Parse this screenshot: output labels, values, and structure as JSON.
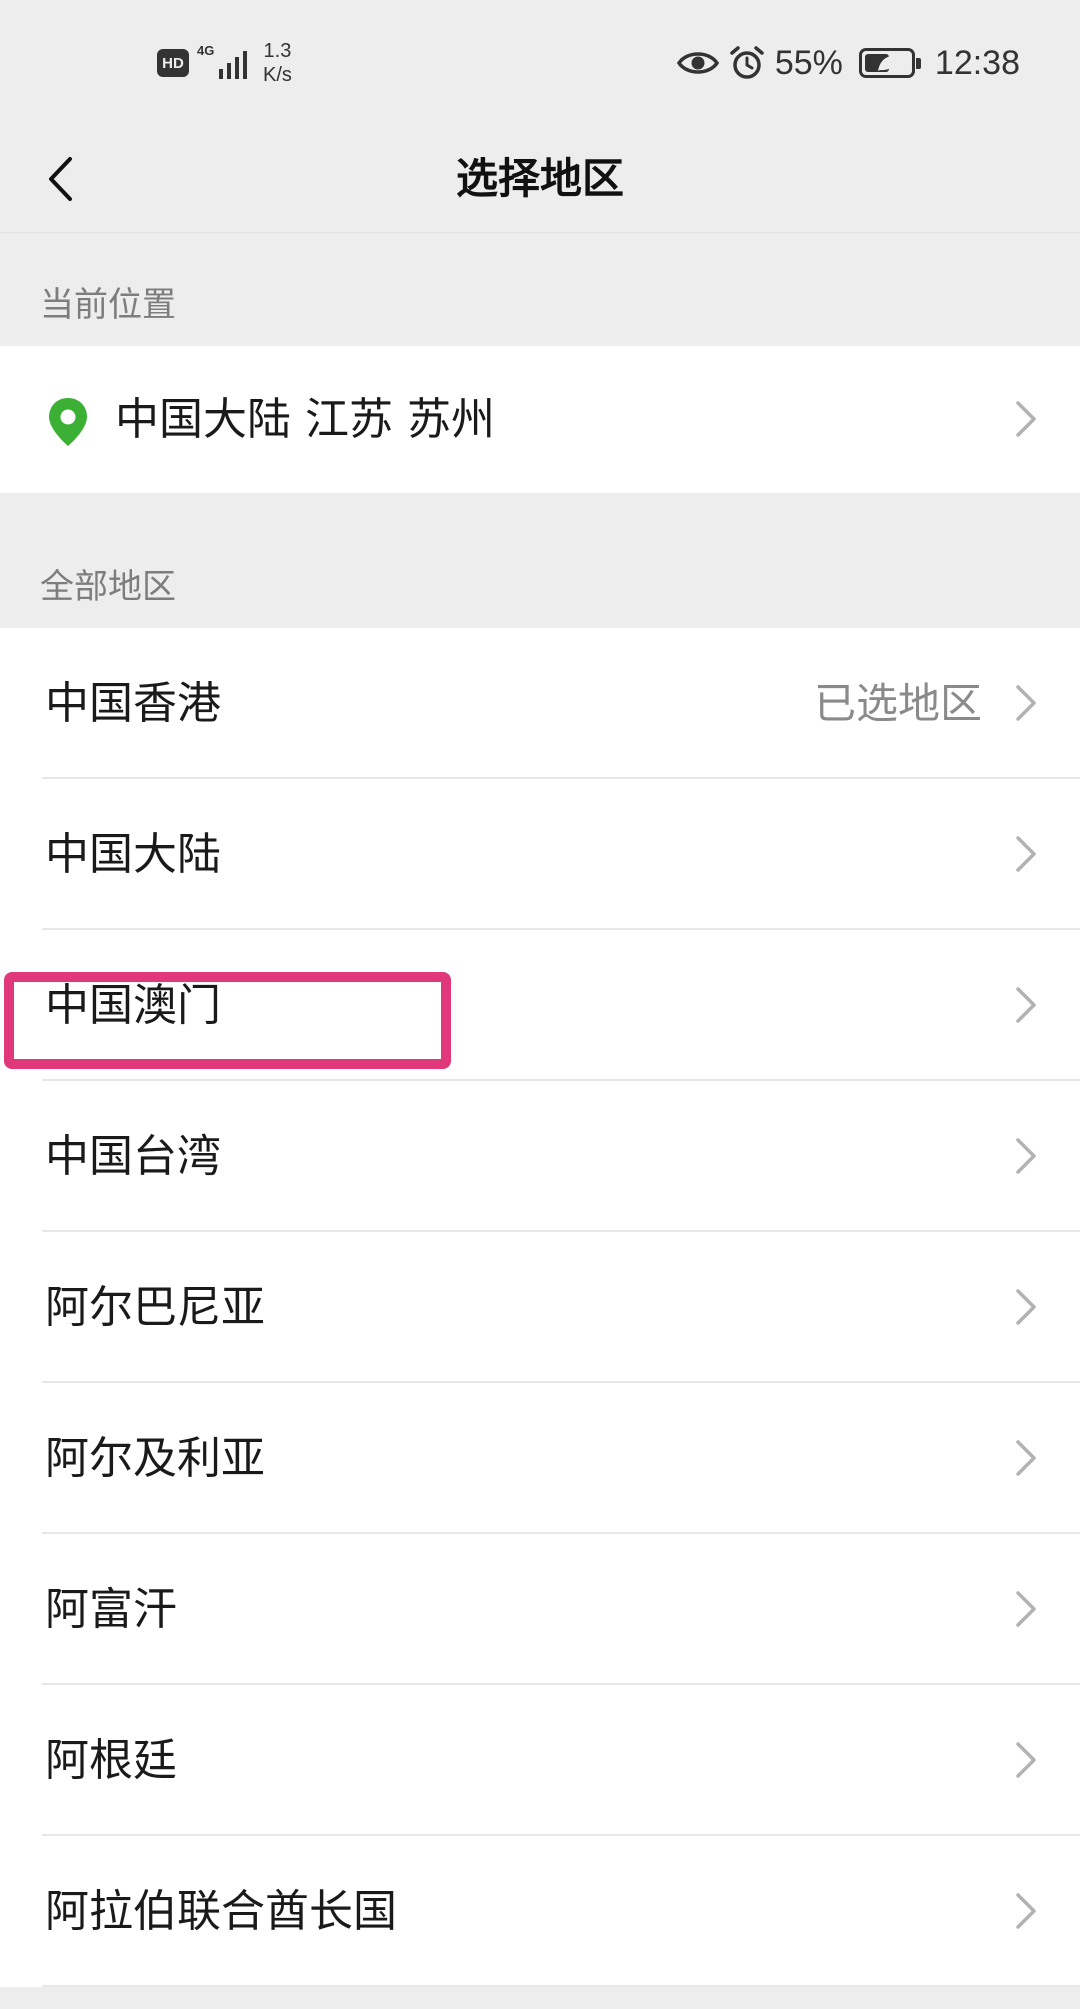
{
  "status_bar": {
    "hd_badge": "HD",
    "network": "4G",
    "speed_value": "1.3",
    "speed_unit": "K/s",
    "battery_percent": "55%",
    "battery_level": 0.55,
    "time": "12:38"
  },
  "nav": {
    "title": "选择地区"
  },
  "current_location": {
    "header": "当前位置",
    "value": "中国大陆 江苏 苏州"
  },
  "all_regions": {
    "header": "全部地区",
    "selected_tag": "已选地区",
    "items": [
      {
        "label": "中国香港"
      },
      {
        "label": "中国大陆"
      },
      {
        "label": "中国澳门"
      },
      {
        "label": "中国台湾"
      },
      {
        "label": "阿尔巴尼亚"
      },
      {
        "label": "阿尔及利亚"
      },
      {
        "label": "阿富汗"
      },
      {
        "label": "阿根廷"
      },
      {
        "label": "阿拉伯联合酋长国"
      }
    ]
  },
  "colors": {
    "pin": "#3cb035",
    "highlight": "#e0387a",
    "background": "#ededed"
  }
}
